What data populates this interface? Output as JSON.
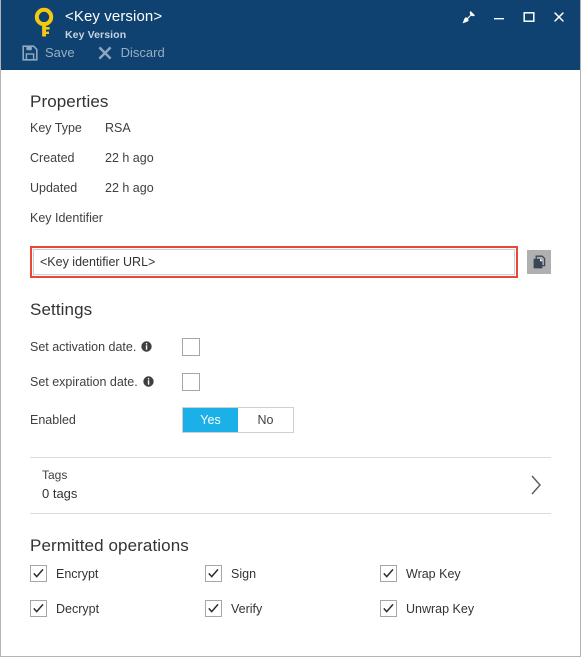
{
  "window": {
    "title": "<Key version>",
    "subtitle": "Key Version",
    "key_icon": "key-icon",
    "controls": [
      {
        "name": "pin-icon",
        "label": "Pin"
      },
      {
        "name": "minimize-icon",
        "label": "Minimize"
      },
      {
        "name": "maximize-icon",
        "label": "Maximize"
      },
      {
        "name": "close-icon",
        "label": "Close"
      }
    ]
  },
  "toolbar": {
    "save_label": "Save",
    "save_icon": "save-disk-icon",
    "discard_label": "Discard",
    "discard_icon": "close-x-icon"
  },
  "properties": {
    "heading": "Properties",
    "rows": [
      {
        "label": "Key Type",
        "value": "RSA"
      },
      {
        "label": "Created",
        "value": "22 h ago"
      },
      {
        "label": "Updated",
        "value": "22 h ago"
      },
      {
        "label": "Key Identifier",
        "value": ""
      }
    ],
    "key_identifier": {
      "value": "<Key identifier URL>",
      "placeholder": "<Key identifier URL>",
      "copy_icon": "copy-icon",
      "highlight_color": "#e8483a"
    }
  },
  "settings": {
    "heading": "Settings",
    "activation": {
      "label": "Set activation date.",
      "info_icon": "info-icon",
      "checked": false
    },
    "expiration": {
      "label": "Set expiration date.",
      "info_icon": "info-icon",
      "checked": false
    },
    "enabled": {
      "label": "Enabled",
      "yes_label": "Yes",
      "no_label": "No",
      "selected": "Yes",
      "accent_color": "#1cb0e8"
    }
  },
  "tags": {
    "title": "Tags",
    "count_label": "0 tags",
    "chevron_icon": "chevron-right-icon"
  },
  "permitted_operations": {
    "heading": "Permitted operations",
    "items": [
      {
        "label": "Encrypt",
        "checked": true
      },
      {
        "label": "Sign",
        "checked": true
      },
      {
        "label": "Wrap Key",
        "checked": true
      },
      {
        "label": "Decrypt",
        "checked": true
      },
      {
        "label": "Verify",
        "checked": true
      },
      {
        "label": "Unwrap Key",
        "checked": true
      }
    ]
  }
}
